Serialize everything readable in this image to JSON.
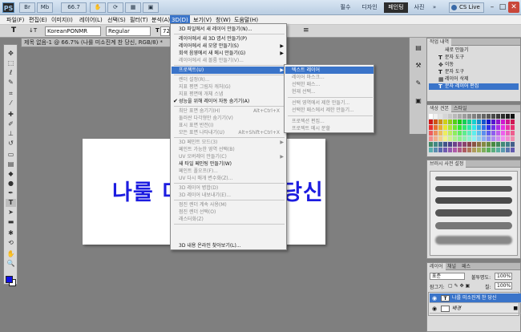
{
  "titlebar": {
    "app_logo": "PS",
    "zoom": "66.7",
    "workspaces": [
      "필수",
      "디자인",
      "페인팅",
      "사진"
    ],
    "active_workspace": "페인팅",
    "more": "»",
    "cs_live": "CS Live",
    "minimize": "–",
    "maximize": "□",
    "close": "✕"
  },
  "menubar": {
    "items": [
      "파일(F)",
      "편집(E)",
      "이미지(I)",
      "레이어(L)",
      "선택(S)",
      "필터(T)",
      "분석(A)",
      "3D(D)",
      "보기(V)",
      "창(W)",
      "도움말(H)"
    ],
    "open_item": "3D(D)"
  },
  "optbar": {
    "tool_icon": "T",
    "orientation_icon": "↓T",
    "font_family": "KoreanPONMR",
    "font_style": "Regular",
    "font_size": "72 pt",
    "right_icon": "≡"
  },
  "document_tab": {
    "title": "제목 없음-1 @ 66.7% (나룰 미소진계 찬 당신, RGB/8) *",
    "close": "×"
  },
  "canvas": {
    "text": "나룰 미소진계 찬 당신",
    "text_color": "#1c1ce0"
  },
  "dropdown_3d": {
    "items": [
      {
        "label": "3D 파일에서 새 레이어 만들기(N)...",
        "disabled": false
      },
      {
        "sep": true
      },
      {
        "label": "레이어에서 새 3D 엽서 만들기(P)",
        "disabled": false
      },
      {
        "label": "레이어에서 새 모양 만들기(S)",
        "disabled": false,
        "submenu": true
      },
      {
        "label": "회색 음영에서 새 메시 만들기(G)",
        "disabled": false,
        "submenu": true
      },
      {
        "label": "레이어에서 새 볼륨 만들기(V)...",
        "disabled": true
      },
      {
        "sep": true
      },
      {
        "label": "프로젝트(U)",
        "disabled": false,
        "submenu": true,
        "highlighted": true
      },
      {
        "sep": true
      },
      {
        "label": "렌더 설정(R)...",
        "disabled": true
      },
      {
        "label": "지표 평면 그림자 캐처(G)",
        "disabled": true
      },
      {
        "label": "지표 평면에 개체 스냅",
        "disabled": true
      },
      {
        "label": "성능을 위해 레이어 자동 숨기기(A)",
        "disabled": false,
        "checked": true
      },
      {
        "sep": true
      },
      {
        "label": "최단 표면 숨기기(H)",
        "disabled": true,
        "shortcut": "Alt+Ctrl+X"
      },
      {
        "label": "둘러싼 다각형만 숨기기(V)",
        "disabled": true
      },
      {
        "label": "표시 표면 반전(I)",
        "disabled": true
      },
      {
        "label": "모든 표면 나타내기(U)",
        "disabled": true,
        "shortcut": "Alt+Shift+Ctrl+X"
      },
      {
        "sep": true
      },
      {
        "label": "3D 페인트 모드(3)",
        "disabled": true,
        "submenu": true
      },
      {
        "label": "페인트 가능한 영역 선택(B)",
        "disabled": true
      },
      {
        "label": "UV 오버레이 만들기(C)",
        "disabled": true,
        "submenu": true
      },
      {
        "label": "새 타일 페인팅 만들기(W)",
        "disabled": false
      },
      {
        "label": "페인트 폴오프(F)...",
        "disabled": true
      },
      {
        "label": "UV 다시 매개 변수화(Z)...",
        "disabled": true
      },
      {
        "sep": true
      },
      {
        "label": "3D 레이어 병합(D)",
        "disabled": true
      },
      {
        "label": "3D 레이어 내보내기(E)...",
        "disabled": true
      },
      {
        "sep": true
      },
      {
        "label": "점진 렌더 계속 사용(M)",
        "disabled": true
      },
      {
        "label": "점진 렌더 선택(O)",
        "disabled": true
      },
      {
        "label": "래스터화(Z)",
        "disabled": true
      },
      {
        "sep": true
      },
      {
        "label": "3D 내용 온라인 찾아보기(L)...",
        "disabled": false
      }
    ]
  },
  "submenu_project": {
    "items": [
      {
        "label": "텍스트 레이어",
        "highlighted": true
      },
      {
        "label": "레이어 마스크...",
        "enabled": false
      },
      {
        "label": "선택한 패스...",
        "enabled": false
      },
      {
        "label": "현재 선택...",
        "enabled": false
      },
      {
        "sep": true
      },
      {
        "label": "선택 영역에서 제한 만들기...",
        "enabled": false
      },
      {
        "label": "선택한 패스에서 제한 만들기...",
        "enabled": false
      },
      {
        "sep": true
      },
      {
        "label": "프로젝션 편집...",
        "enabled": false
      },
      {
        "label": "프로젝트 메시 분할",
        "enabled": false
      }
    ]
  },
  "history_panel": {
    "tab_label": "작업 내역",
    "rows": [
      {
        "label": "새로 만들기",
        "icon": ""
      },
      {
        "label": "문자 도구",
        "icon": "T"
      },
      {
        "label": "이동",
        "icon": "✥"
      },
      {
        "label": "문자 도구",
        "icon": "T"
      },
      {
        "label": "레이어 삭제",
        "icon": "▦"
      },
      {
        "label": "문자 레이어 편집",
        "icon": "T",
        "selected": true
      }
    ]
  },
  "swatches_panel": {
    "tabs": [
      "색상 견본",
      "스타일"
    ]
  },
  "brush_panel": {
    "tab_label": "브러시 사전 설정"
  },
  "layers_panel": {
    "tabs": [
      "레이어",
      "채널",
      "패스"
    ],
    "blend_mode": "표준",
    "opacity_label": "불투명도:",
    "opacity_value": "100%",
    "lock_label": "잠그기:",
    "fill_label": "칠:",
    "fill_value": "100%",
    "layers": [
      {
        "name": "나룰 미소진계 찬 당신",
        "thumb": "T",
        "selected": true
      },
      {
        "name": "배경",
        "thumb": "",
        "selected": false,
        "locked": true
      }
    ]
  },
  "icons": {
    "eye": "👁",
    "lock": "🔒",
    "checkmark": "✔",
    "submenu_arrow": "▶"
  }
}
